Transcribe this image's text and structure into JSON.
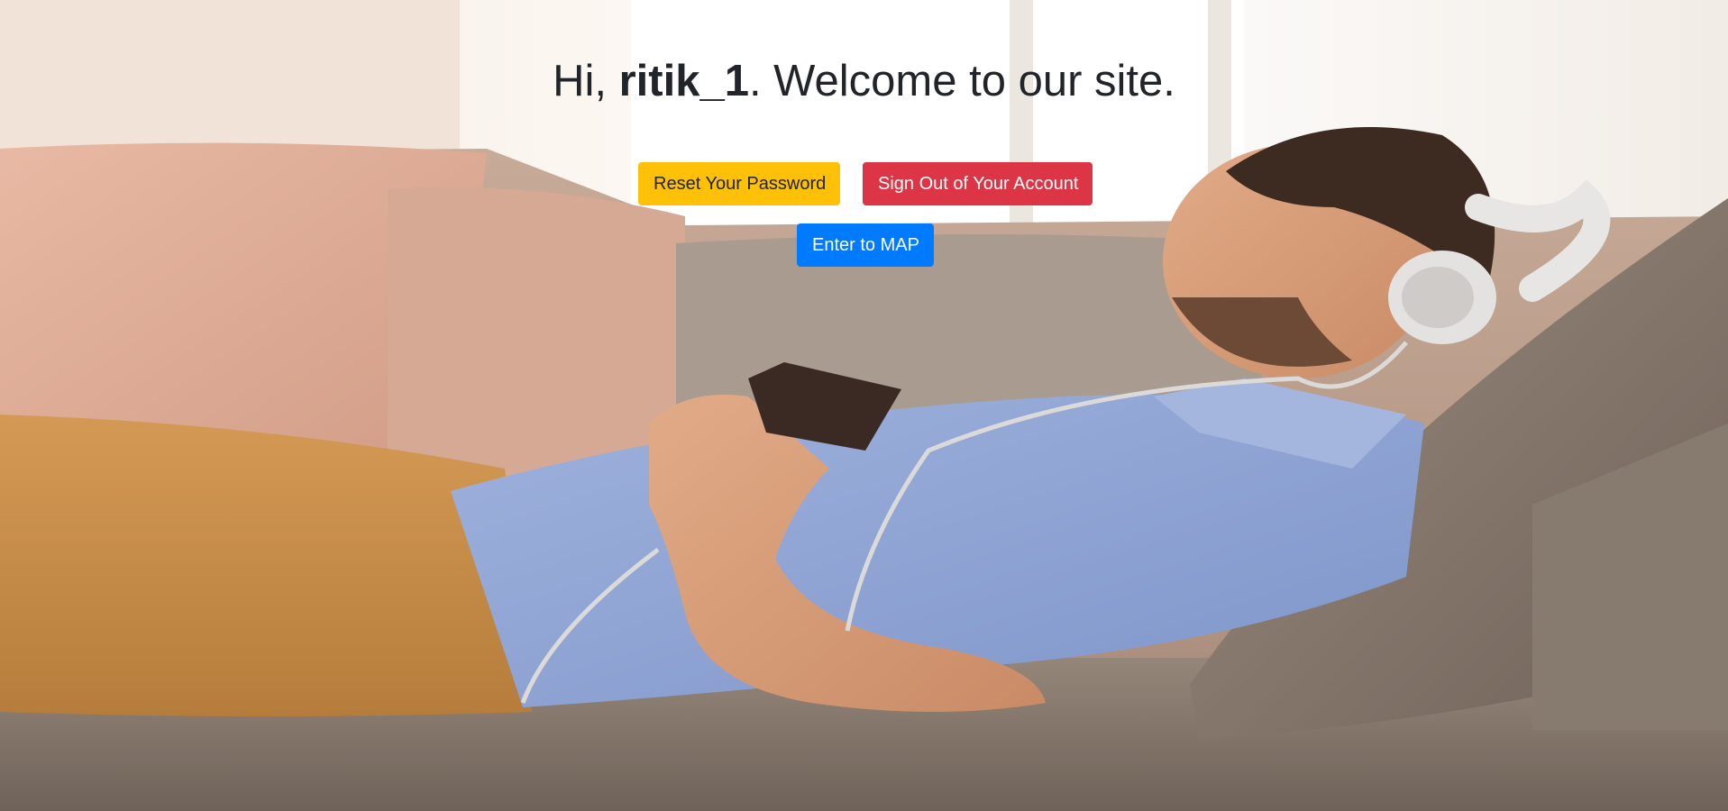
{
  "greeting": {
    "prefix": "Hi, ",
    "username": "ritik_1",
    "suffix": ". Welcome to our site."
  },
  "buttons": {
    "reset_password": "Reset Your Password",
    "sign_out": "Sign Out of Your Account",
    "enter_map": "Enter to MAP"
  },
  "colors": {
    "reset_button": "#ffc107",
    "sign_out_button": "#dc3545",
    "map_button": "#007bff",
    "text": "#212529"
  },
  "background": {
    "image_icon": "photo-man-on-couch-with-headphones"
  }
}
